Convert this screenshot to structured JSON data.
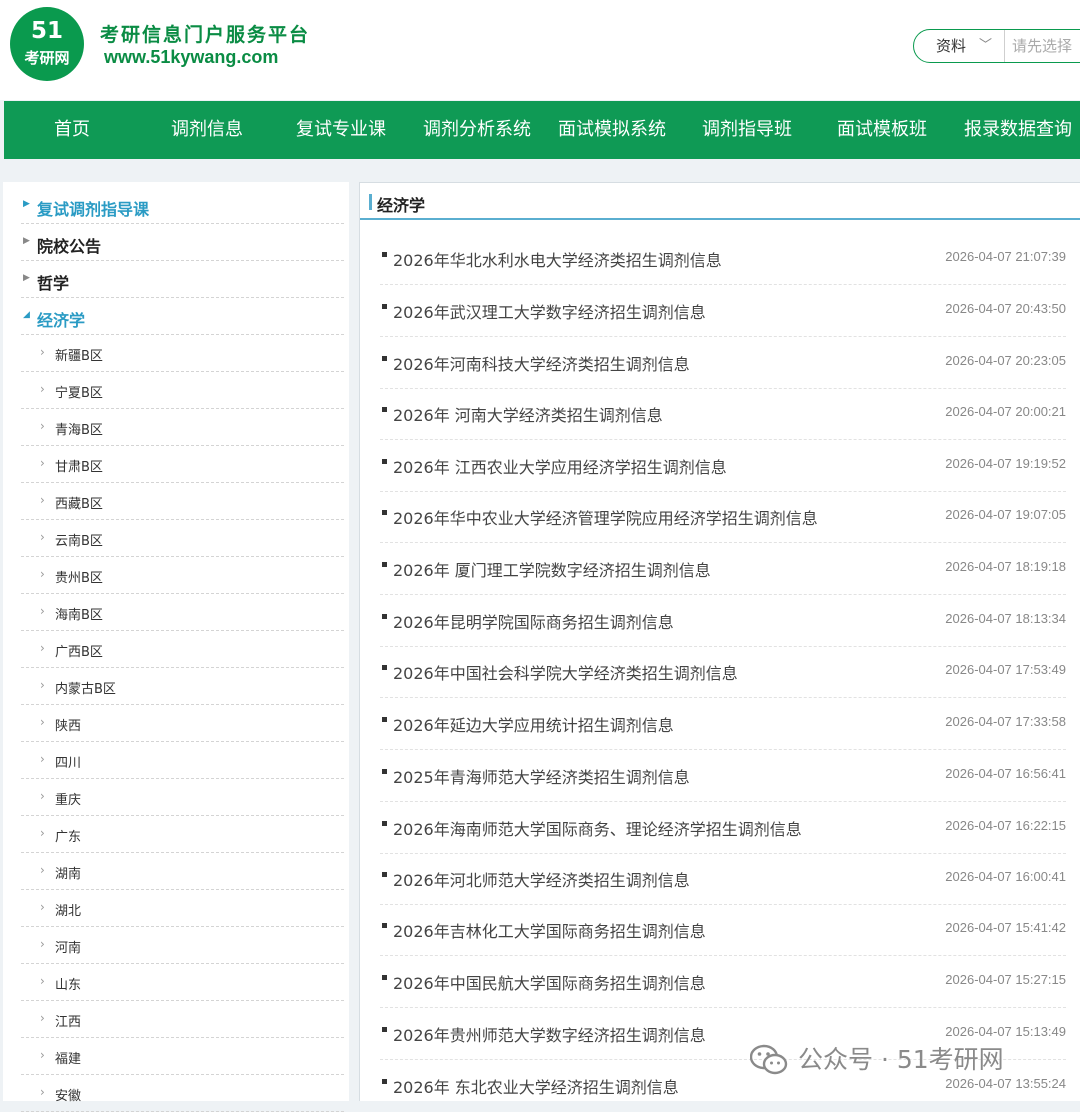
{
  "header": {
    "logo_num": "51",
    "logo_text": "考研网",
    "slogan": "考研信息门户服务平台",
    "url": "www.51kywang.com",
    "search": {
      "select_label": "资料",
      "placeholder": "请先选择"
    }
  },
  "nav": {
    "items": [
      {
        "label": "首页"
      },
      {
        "label": "调剂信息"
      },
      {
        "label": "复试专业课"
      },
      {
        "label": "调剂分析系统"
      },
      {
        "label": "面试模拟系统"
      },
      {
        "label": "调剂指导班"
      },
      {
        "label": "面试模板班"
      },
      {
        "label": "报录数据查询"
      }
    ]
  },
  "sidebar": {
    "top_items": [
      {
        "label": "复试调剂指导课"
      },
      {
        "label": "院校公告"
      },
      {
        "label": "哲学"
      },
      {
        "label": "经济学"
      }
    ],
    "sub_items": [
      {
        "label": "新疆B区"
      },
      {
        "label": "宁夏B区"
      },
      {
        "label": "青海B区"
      },
      {
        "label": "甘肃B区"
      },
      {
        "label": "西藏B区"
      },
      {
        "label": "云南B区"
      },
      {
        "label": "贵州B区"
      },
      {
        "label": "海南B区"
      },
      {
        "label": "广西B区"
      },
      {
        "label": "内蒙古B区"
      },
      {
        "label": "陕西"
      },
      {
        "label": "四川"
      },
      {
        "label": "重庆"
      },
      {
        "label": "广东"
      },
      {
        "label": "湖南"
      },
      {
        "label": "湖北"
      },
      {
        "label": "河南"
      },
      {
        "label": "山东"
      },
      {
        "label": "江西"
      },
      {
        "label": "福建"
      },
      {
        "label": "安徽"
      }
    ]
  },
  "main": {
    "title": "经济学",
    "articles": [
      {
        "title": "2026年华北水利水电大学经济类招生调剂信息",
        "date": "2026-04-07 21:07:39"
      },
      {
        "title": "2026年武汉理工大学数字经济招生调剂信息",
        "date": "2026-04-07 20:43:50"
      },
      {
        "title": "2026年河南科技大学经济类招生调剂信息",
        "date": "2026-04-07 20:23:05"
      },
      {
        "title": "2026年 河南大学经济类招生调剂信息",
        "date": "2026-04-07 20:00:21"
      },
      {
        "title": "2026年 江西农业大学应用经济学招生调剂信息",
        "date": "2026-04-07 19:19:52"
      },
      {
        "title": "2026年华中农业大学经济管理学院应用经济学招生调剂信息",
        "date": "2026-04-07 19:07:05"
      },
      {
        "title": "2026年 厦门理工学院数字经济招生调剂信息",
        "date": "2026-04-07 18:19:18"
      },
      {
        "title": "2026年昆明学院国际商务招生调剂信息",
        "date": "2026-04-07 18:13:34"
      },
      {
        "title": "2026年中国社会科学院大学经济类招生调剂信息",
        "date": "2026-04-07 17:53:49"
      },
      {
        "title": "2026年延边大学应用统计招生调剂信息",
        "date": "2026-04-07 17:33:58"
      },
      {
        "title": "2025年青海师范大学经济类招生调剂信息",
        "date": "2026-04-07 16:56:41"
      },
      {
        "title": "2026年海南师范大学国际商务、理论经济学招生调剂信息",
        "date": "2026-04-07 16:22:15"
      },
      {
        "title": "2026年河北师范大学经济类招生调剂信息",
        "date": "2026-04-07 16:00:41"
      },
      {
        "title": "2026年吉林化工大学国际商务招生调剂信息",
        "date": "2026-04-07 15:41:42"
      },
      {
        "title": "2026年中国民航大学国际商务招生调剂信息",
        "date": "2026-04-07 15:27:15"
      },
      {
        "title": "2026年贵州师范大学数字经济招生调剂信息",
        "date": "2026-04-07 15:13:49"
      },
      {
        "title": "2026年 东北农业大学经济招生调剂信息",
        "date": "2026-04-07 13:55:24"
      }
    ]
  },
  "watermark": {
    "text": "公众号 · 51考研网"
  }
}
